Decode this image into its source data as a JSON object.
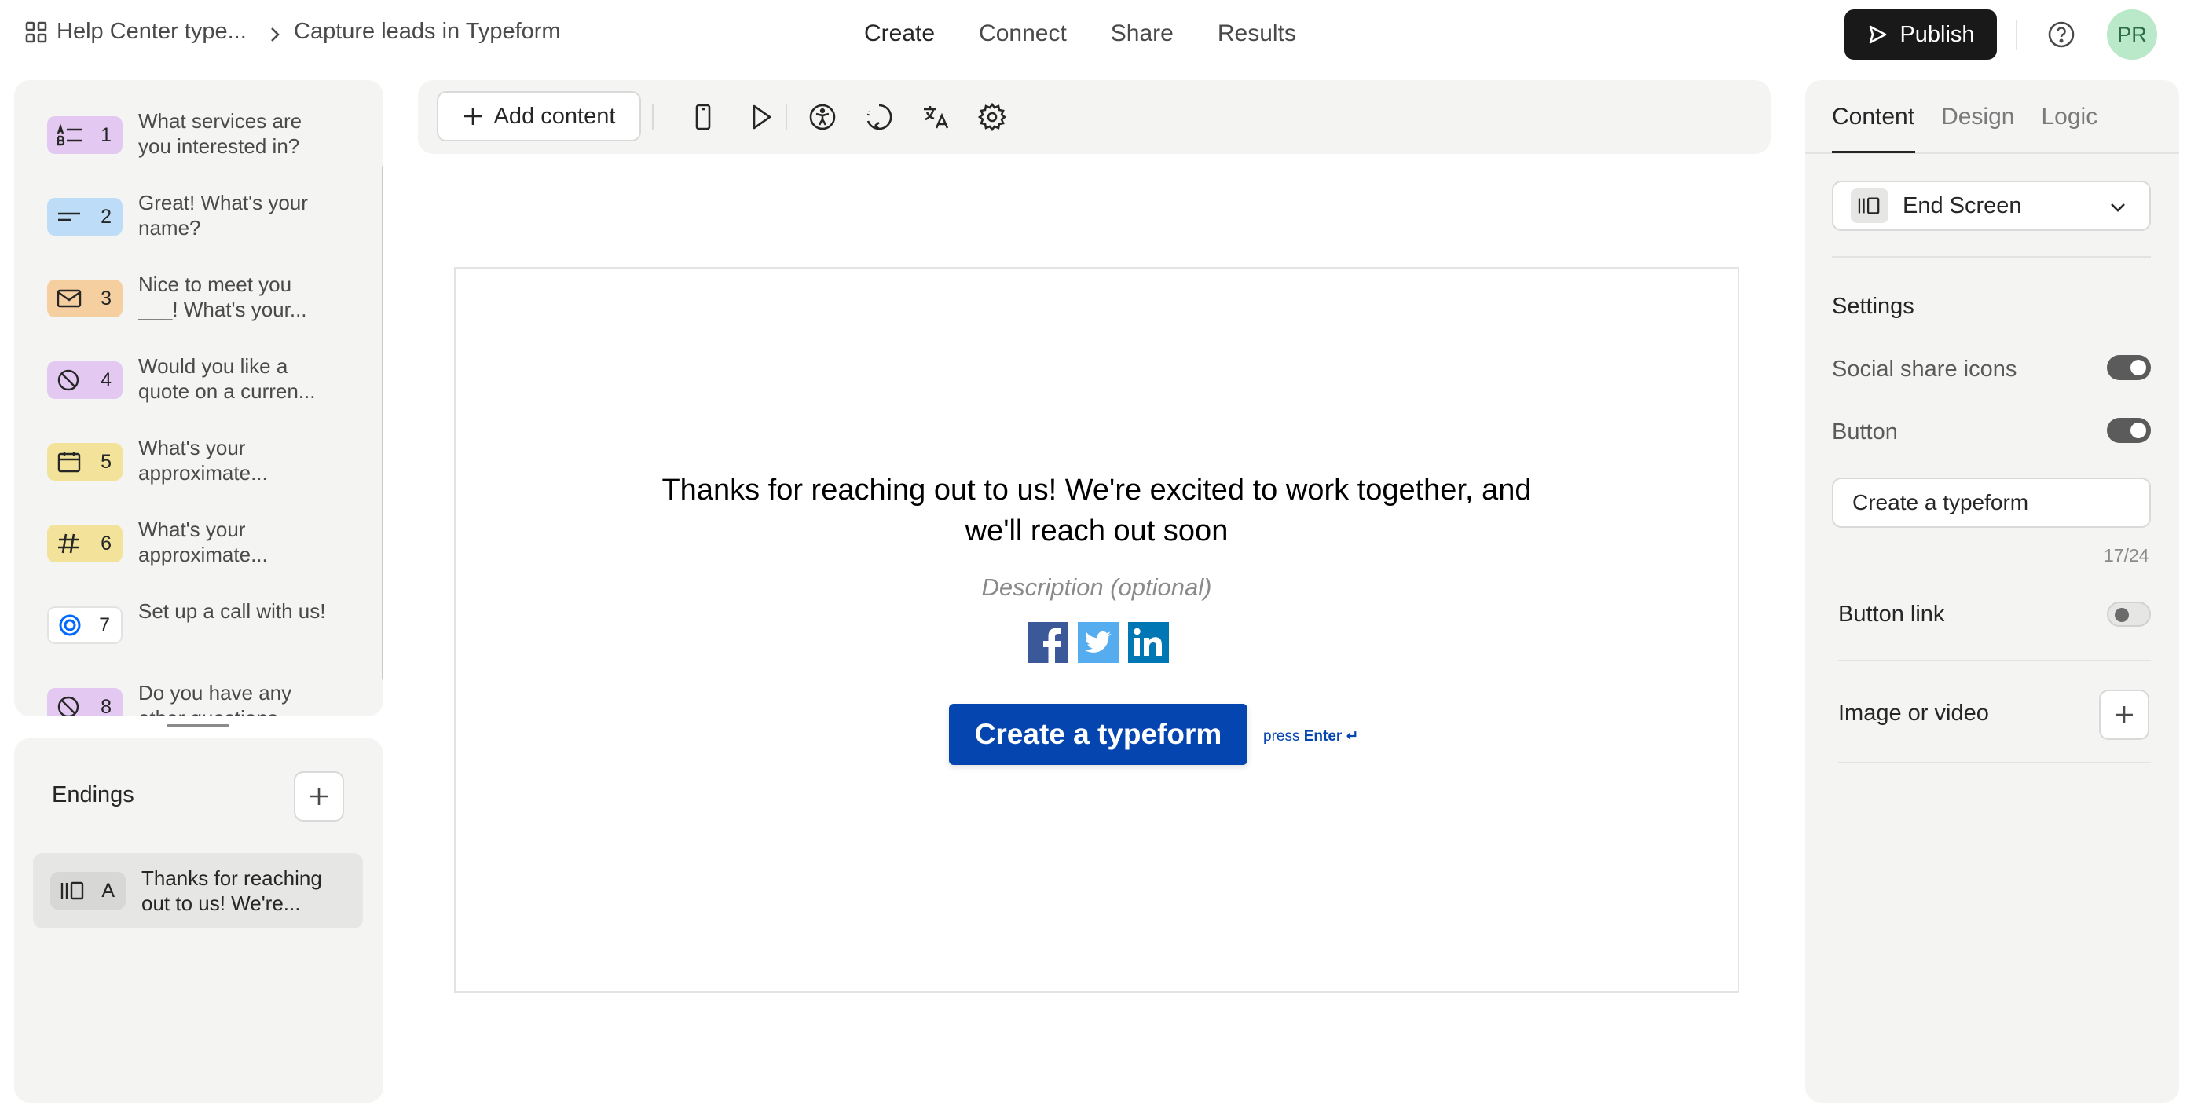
{
  "breadcrumb": {
    "workspace": "Help Center type...",
    "form": "Capture leads in Typeform"
  },
  "nav": {
    "create": "Create",
    "connect": "Connect",
    "share": "Share",
    "results": "Results"
  },
  "header": {
    "publish_label": "Publish",
    "avatar_initials": "PR"
  },
  "questions": [
    {
      "num": "1",
      "text": "What services are you interested in?",
      "color": "#e3c9f1",
      "icon": "multiple-choice-icon"
    },
    {
      "num": "2",
      "text": "Great! What's your name?",
      "color": "#bcdcf7",
      "icon": "short-text-icon"
    },
    {
      "num": "3",
      "text": "Nice to meet you ___! What's your...",
      "color": "#f6cfa1",
      "icon": "email-icon"
    },
    {
      "num": "4",
      "text": "Would you like a quote on a curren...",
      "color": "#e3c9f1",
      "icon": "legal-icon"
    },
    {
      "num": "5",
      "text": "What's your approximate...",
      "color": "#f3e39a",
      "icon": "calendar-icon"
    },
    {
      "num": "6",
      "text": "What's your approximate...",
      "color": "#f3e39a",
      "icon": "number-icon"
    },
    {
      "num": "7",
      "text": "Set up a call with us!",
      "color": "#ffffff",
      "icon": "calendly-icon"
    },
    {
      "num": "8",
      "text": "Do you have any other questions...",
      "color": "#e3c9f1",
      "icon": "legal-icon"
    }
  ],
  "endings": {
    "title": "Endings",
    "items": [
      {
        "letter": "A",
        "text": "Thanks for reaching out to us! We're..."
      }
    ]
  },
  "toolbar": {
    "add_content_label": "Add content"
  },
  "end_screen": {
    "title_line1": "Thanks for reaching out to us! We're excited to work together, and",
    "title_line2": "we'll reach out soon",
    "description_placeholder": "Description (optional)",
    "button_label": "Create a typeform",
    "press_hint": "press",
    "press_key": "Enter ↵",
    "button_color": "#0445af"
  },
  "right_panel": {
    "tabs": [
      "Content",
      "Design",
      "Logic"
    ],
    "screen_type": "End Screen",
    "settings_title": "Settings",
    "social_share_label": "Social share icons",
    "social_share_on": true,
    "button_label": "Button",
    "button_on": true,
    "button_text_value": "Create a typeform",
    "button_text_counter": "17/24",
    "button_link_label": "Button link",
    "button_link_on": false,
    "image_video_label": "Image or video"
  }
}
